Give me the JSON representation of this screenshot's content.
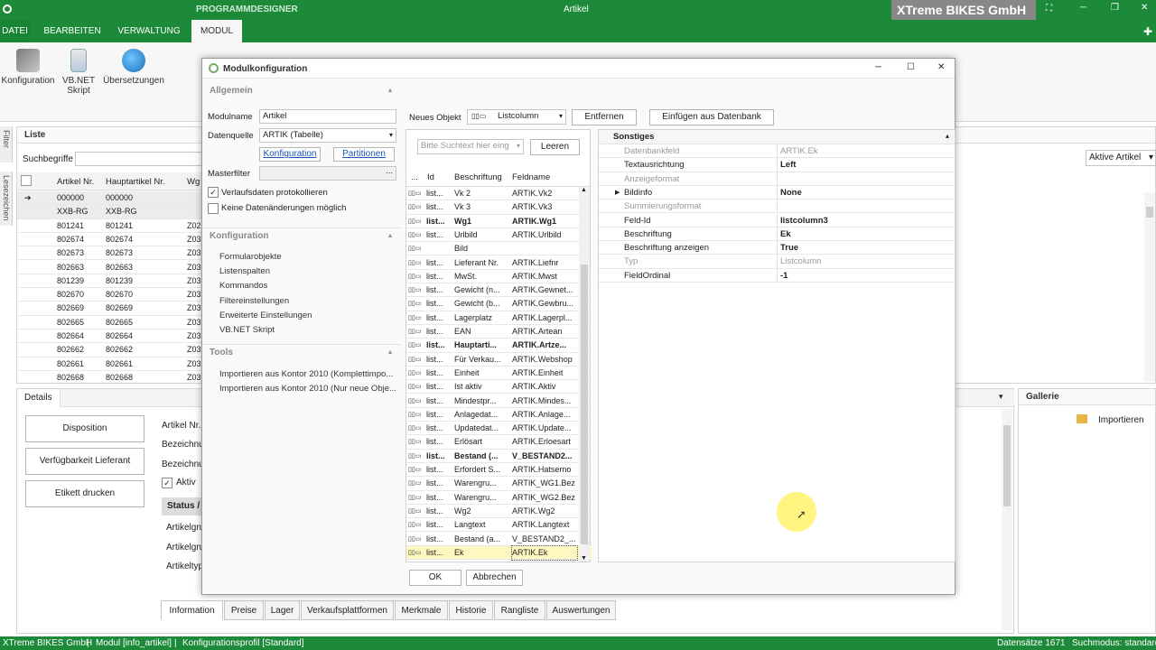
{
  "titlebar": {
    "app_label": "PROGRAMMDESIGNER",
    "window_title": "Artikel",
    "company": "XTreme BIKES GmbH"
  },
  "menu": {
    "items": [
      "DATEI",
      "BEARBEITEN",
      "VERWALTUNG",
      "MODUL"
    ]
  },
  "ribbon": {
    "buttons": [
      "Konfiguration",
      "VB.NET Skript",
      "Übersetzungen"
    ]
  },
  "left_tabs": {
    "filter": "Filter",
    "lesezeichen": "Lesezeichen"
  },
  "list": {
    "title": "Liste",
    "search_label": "Suchbegriffe",
    "filter_value": "Aktive Artikel",
    "headers": [
      "Artikel Nr.",
      "Hauptartikel Nr.",
      "Wg"
    ],
    "rows": [
      [
        "000000",
        "000000",
        ""
      ],
      [
        "XXB-RG",
        "XXB-RG",
        ""
      ],
      [
        "801241",
        "801241",
        "Z02"
      ],
      [
        "802674",
        "802674",
        "Z03"
      ],
      [
        "802673",
        "802673",
        "Z03"
      ],
      [
        "802663",
        "802663",
        "Z03"
      ],
      [
        "801239",
        "801239",
        "Z03"
      ],
      [
        "802670",
        "802670",
        "Z03"
      ],
      [
        "802669",
        "802669",
        "Z03"
      ],
      [
        "802665",
        "802665",
        "Z03"
      ],
      [
        "802664",
        "802664",
        "Z03"
      ],
      [
        "802662",
        "802662",
        "Z03"
      ],
      [
        "802661",
        "802661",
        "Z03"
      ],
      [
        "802668",
        "802668",
        "Z03"
      ]
    ]
  },
  "details": {
    "title": "Details",
    "buttons": [
      "Disposition",
      "Verfügbarkeit Lieferant",
      "Etikett drucken"
    ],
    "labels": [
      "Artikel Nr.",
      "Bezeichnu",
      "Bezeichnu"
    ],
    "aktiv": "Aktiv",
    "status": "Status /",
    "sub_labels": [
      "Artikelgru",
      "Artikelgru",
      "Artikeltyp"
    ],
    "tabs": [
      "Information",
      "Preise",
      "Lager",
      "Verkaufsplattformen",
      "Merkmale",
      "Historie",
      "Rangliste",
      "Auswertungen"
    ]
  },
  "gallery": {
    "title": "Gallerie",
    "import": "Importieren"
  },
  "dialog": {
    "title": "Modulkonfiguration",
    "allgemein": "Allgemein",
    "modulname_label": "Modulname",
    "modulname_value": "Artikel",
    "datenquelle_label": "Datenquelle",
    "datenquelle_value": "ARTIK (Tabelle)",
    "link_konfiguration": "Konfiguration",
    "link_partitionen": "Partitionen",
    "masterfilter_label": "Masterfilter",
    "ellipsis": "...",
    "cb1": "Verlaufsdaten protokollieren",
    "cb2": "Keine Datenänderungen möglich",
    "konfiguration_head": "Konfiguration",
    "konfig_items": [
      "Formularobjekte",
      "Listenspalten",
      "Kommandos",
      "Filtereinstellungen",
      "Erweiterte Einstellungen",
      "VB.NET Skript"
    ],
    "tools_head": "Tools",
    "tools_items": [
      "Importieren aus Kontor 2010 (Komplettimpo...",
      "Importieren aus Kontor 2010 (Nur neue Obje..."
    ],
    "neues_objekt_label": "Neues Objekt",
    "neues_objekt_value": "Listcolumn",
    "btn_entfernen": "Entfernen",
    "btn_einfuegen": "Einfügen aus Datenbank",
    "search_placeholder": "Bitte Suchtext hier eing",
    "btn_leeren": "Leeren",
    "grid_headers": [
      "...",
      "Id",
      "Beschriftung",
      "Feldname"
    ],
    "grid_rows": [
      [
        "list...",
        "Vk 2",
        "ARTIK.Vk2",
        false
      ],
      [
        "list...",
        "Vk 3",
        "ARTIK.Vk3",
        false
      ],
      [
        "list...",
        "Wg1",
        "ARTIK.Wg1",
        true
      ],
      [
        "list...",
        "Urlbild",
        "ARTIK.Urlbild",
        false
      ],
      [
        "",
        "Bild",
        "",
        false
      ],
      [
        "list...",
        "Lieferant Nr.",
        "ARTIK.Liefnr",
        false
      ],
      [
        "list...",
        "MwSt.",
        "ARTIK.Mwst",
        false
      ],
      [
        "list...",
        "Gewicht (n...",
        "ARTIK.Gewnet...",
        false
      ],
      [
        "list...",
        "Gewicht (b...",
        "ARTIK.Gewbru...",
        false
      ],
      [
        "list...",
        "Lagerplatz",
        "ARTIK.Lagerpl...",
        false
      ],
      [
        "list...",
        "EAN",
        "ARTIK.Artean",
        false
      ],
      [
        "list...",
        "Hauptarti...",
        "ARTIK.Artze...",
        true
      ],
      [
        "list...",
        "Für Verkau...",
        "ARTIK.Webshop",
        false
      ],
      [
        "list...",
        "Einheit",
        "ARTIK.Einheit",
        false
      ],
      [
        "list...",
        "Ist aktiv",
        "ARTIK.Aktiv",
        false
      ],
      [
        "list...",
        "Mindestpr...",
        "ARTIK.Mindes...",
        false
      ],
      [
        "list...",
        "Anlagedat...",
        "ARTIK.Anlage...",
        false
      ],
      [
        "list...",
        "Updatedat...",
        "ARTIK.Update...",
        false
      ],
      [
        "list...",
        "Erlösart",
        "ARTIK.Erloesart",
        false
      ],
      [
        "list...",
        "Bestand (...",
        "V_BESTAND2...",
        true
      ],
      [
        "list...",
        "Erfordert S...",
        "ARTIK.Hatserno",
        false
      ],
      [
        "list...",
        "Warengru...",
        "ARTIK_WG1.Bez",
        false
      ],
      [
        "list...",
        "Warengru...",
        "ARTIK_WG2.Bez",
        false
      ],
      [
        "list...",
        "Wg2",
        "ARTIK.Wg2",
        false
      ],
      [
        "list...",
        "Langtext",
        "ARTIK.Langtext",
        false
      ],
      [
        "list...",
        "Bestand (a...",
        "V_BESTAND2_...",
        false
      ],
      [
        "list...",
        "Ek",
        "ARTIK.Ek",
        false
      ]
    ],
    "props_head": "Sonstiges",
    "props": [
      [
        "Datenbankfeld",
        "ARTIK.Ek",
        false
      ],
      [
        "Textausrichtung",
        "Left",
        true
      ],
      [
        "Anzeigeformat",
        "",
        false
      ],
      [
        "Bildinfo",
        "None",
        true
      ],
      [
        "Summierungsformat",
        "",
        false
      ],
      [
        "Feld-Id",
        "listcolumn3",
        true
      ],
      [
        "Beschriftung",
        "Ek",
        true
      ],
      [
        "Beschriftung anzeigen",
        "True",
        true
      ],
      [
        "Typ",
        "Listcolumn",
        false
      ],
      [
        "FieldOrdinal",
        "-1",
        true
      ]
    ],
    "btn_ok": "OK",
    "btn_abbrechen": "Abbrechen"
  },
  "status": {
    "company": "XTreme BIKES GmbH",
    "modul": "Modul [info_artikel]",
    "profil": "Konfigurationsprofil [Standard]",
    "datensaetze": "Datensätze 1671",
    "suchmodus": "Suchmodus: standard"
  },
  "colors": {
    "accent": "#1d8a3a",
    "selection": "#fff7c0"
  }
}
